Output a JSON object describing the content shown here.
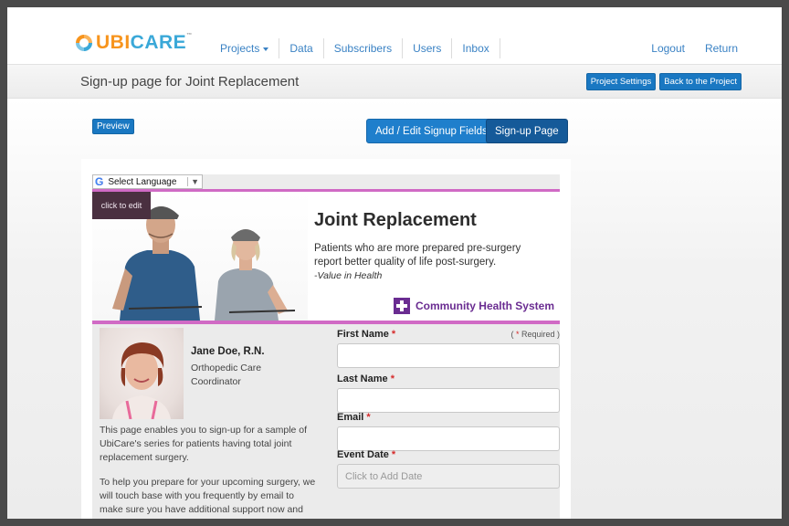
{
  "brand": {
    "name_ubi": "UBI",
    "name_care": "CARE",
    "tm": "™",
    "colors": {
      "orange": "#f7941d",
      "blue": "#3aa8d8"
    }
  },
  "nav": {
    "items": [
      {
        "label": "Projects",
        "dropdown": true
      },
      {
        "label": "Data"
      },
      {
        "label": "Subscribers"
      },
      {
        "label": "Users"
      },
      {
        "label": "Inbox"
      }
    ],
    "right": [
      {
        "label": "Logout"
      },
      {
        "label": "Return"
      }
    ]
  },
  "titlebar": {
    "title": "Sign-up page for Joint Replacement",
    "project_settings": "Project Settings",
    "back_to_project": "Back to the Project"
  },
  "toolbar": {
    "preview": "Preview",
    "add_edit_fields": "Add / Edit Signup Fields",
    "signup_page": "Sign-up Page"
  },
  "signup": {
    "language": {
      "g_icon": "G",
      "label": "Select Language",
      "arrow": "▼"
    },
    "banner": {
      "click_to_edit": "click to edit",
      "title": "Joint Replacement",
      "line1": "Patients who are more prepared pre-surgery",
      "line2": "report better quality of life post-surgery.",
      "quote": "-Value in Health",
      "org": "Community Health System",
      "org_color": "#6a2c91",
      "accent": "#d06ac5"
    },
    "contact": {
      "name": "Jane Doe, R.N.",
      "role_line1": "Orthopedic Care",
      "role_line2": "Coordinator"
    },
    "description": [
      "This page enables you to sign-up for a sample of",
      "UbiCare's series for patients having total joint",
      "replacement surgery.",
      "To help you prepare for your upcoming surgery, we",
      "will touch base with you frequently by email to",
      "make sure you have additional support now and"
    ],
    "form": {
      "required_open": "( ",
      "required_star": "*",
      "required_text": " Required )",
      "star": "*",
      "fields": [
        {
          "label": "First Name",
          "value": "",
          "placeholder": ""
        },
        {
          "label": "Last Name",
          "value": "",
          "placeholder": ""
        },
        {
          "label": "Email",
          "value": "",
          "placeholder": ""
        },
        {
          "label": "Event Date",
          "value": "",
          "placeholder": "Click to Add Date"
        }
      ]
    }
  }
}
